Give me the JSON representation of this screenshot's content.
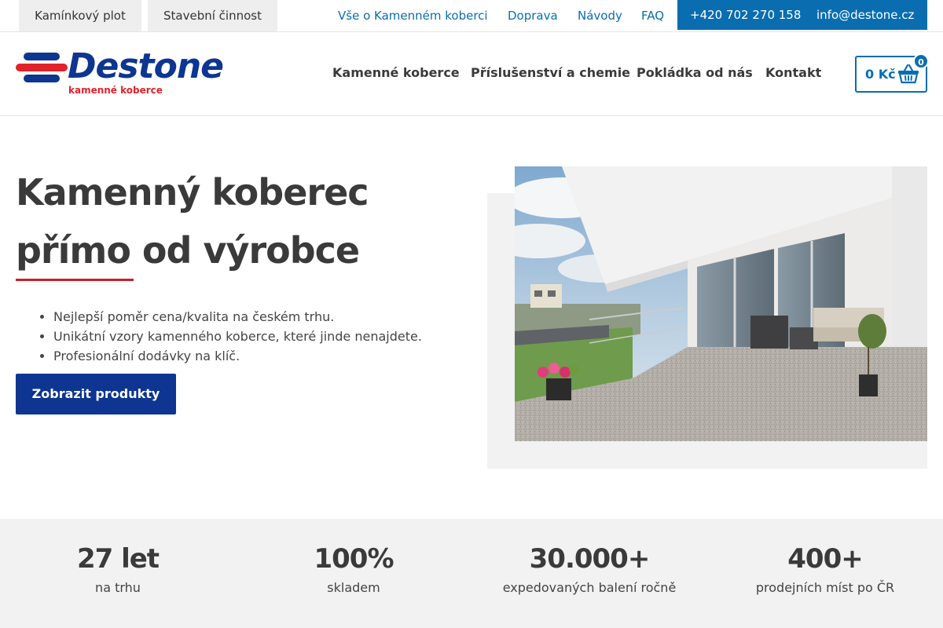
{
  "topbar": {
    "tabs": [
      "Kamínkový plot",
      "Stavební činnost"
    ],
    "links": [
      "Vše o Kamenném koberci",
      "Doprava",
      "Návody",
      "FAQ"
    ],
    "phone": "+420 702 270 158",
    "email": "info@destone.cz"
  },
  "header": {
    "logo_text": "Destone",
    "logo_tagline": "kamenné koberce",
    "nav": [
      "Kamenné koberce",
      "Příslušenství a chemie",
      "Pokládka od nás",
      "Kontakt"
    ],
    "cart": {
      "price": "0 Kč",
      "count": "0"
    }
  },
  "hero": {
    "title_line1": "Kamenný koberec",
    "title_line2": "přímo od výrobce",
    "bullets": [
      "Nejlepší poměr cena/kvalita na českém trhu.",
      "Unikátní vzory kamenného koberce, které jinde nenajdete.",
      "Profesionální dodávky na klíč."
    ],
    "cta_label": "Zobrazit produkty"
  },
  "stats": [
    {
      "value": "27 let",
      "label": "na trhu"
    },
    {
      "value": "100%",
      "label": "skladem"
    },
    {
      "value": "30.000+",
      "label": "expedovaných balení ročně"
    },
    {
      "value": "400+",
      "label": "prodejních míst po ČR"
    }
  ],
  "colors": {
    "brand_blue": "#0d3591",
    "link_blue": "#0a6db0",
    "accent_red": "#e0232a",
    "band_grey": "#f2f2f2"
  },
  "icons": {
    "cart": "shopping-basket-icon"
  }
}
